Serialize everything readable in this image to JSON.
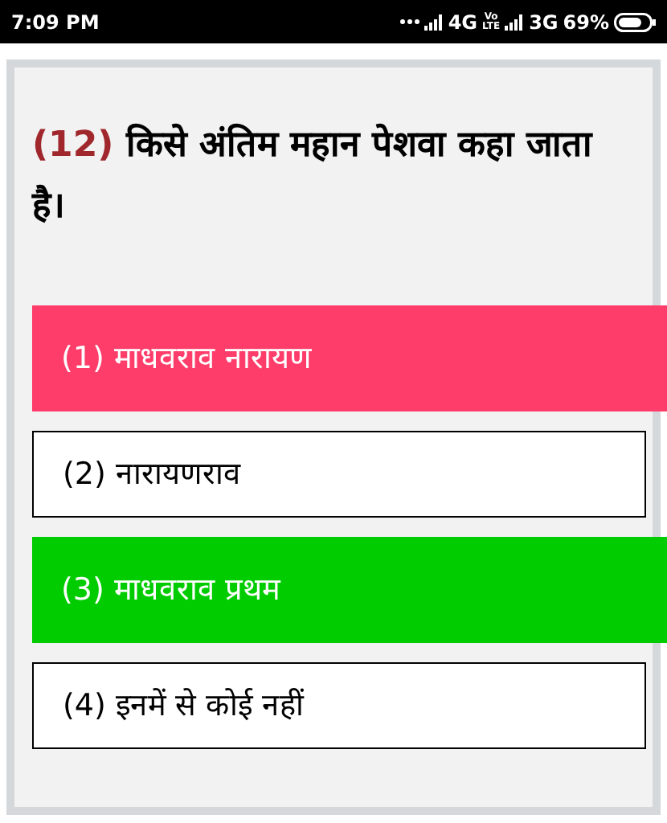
{
  "status_bar": {
    "time": "7:09 PM",
    "network_1": "4G",
    "volte_top": "Vo",
    "volte_bottom": "LTE",
    "network_2": "3G",
    "battery": "69%"
  },
  "question": {
    "number": "(12)",
    "text": "किसे अंतिम महान पेशवा कहा जाता है।"
  },
  "options": [
    {
      "label": "(1) माधवराव नारायण",
      "kind": "wrong"
    },
    {
      "label": "(2) नारायणराव",
      "kind": "plain"
    },
    {
      "label": "(3) माधवराव प्रथम",
      "kind": "correct"
    },
    {
      "label": "(4) इनमें से कोई नहीं",
      "kind": "plain"
    }
  ]
}
